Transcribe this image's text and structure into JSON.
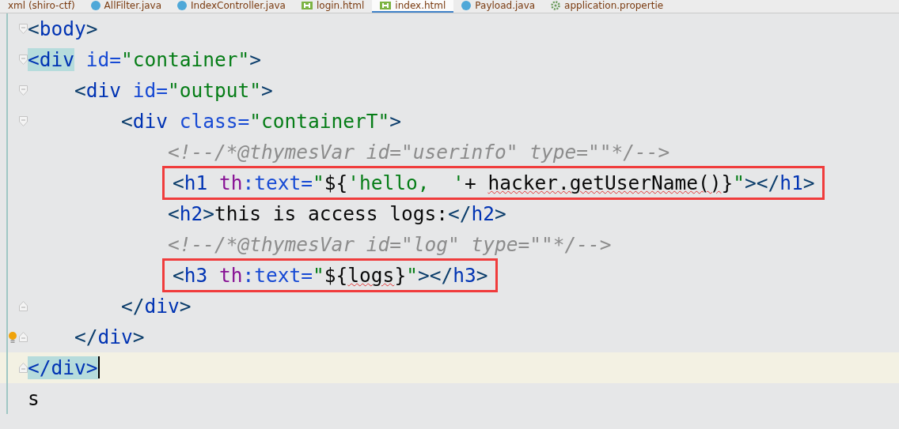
{
  "tabs": [
    {
      "label": "xml (shiro-ctf)",
      "kind": "xml",
      "selected": false
    },
    {
      "label": "AllFilter.java",
      "kind": "java",
      "selected": false
    },
    {
      "label": "IndexController.java",
      "kind": "java",
      "selected": false
    },
    {
      "label": "login.html",
      "kind": "html",
      "selected": false
    },
    {
      "label": "index.html",
      "kind": "html",
      "selected": true
    },
    {
      "label": "Payload.java",
      "kind": "java",
      "selected": false
    },
    {
      "label": "application.propertie",
      "kind": "properties",
      "selected": false
    }
  ],
  "editor": {
    "lines": [
      {
        "fold_open": true,
        "fold_close": false,
        "current": false,
        "bulb": false,
        "annotated": false,
        "tokens": [
          {
            "kind": "punct",
            "text": "<"
          },
          {
            "kind": "tag",
            "text": "body"
          },
          {
            "kind": "punct",
            "text": ">"
          }
        ]
      },
      {
        "fold_open": true,
        "fold_close": false,
        "current": false,
        "bulb": false,
        "annotated": false,
        "tokens": [
          {
            "kind": "tag",
            "text": "<div",
            "matched": true
          },
          {
            "kind": "attr",
            "text": " id="
          },
          {
            "kind": "string",
            "text": "\"container\""
          },
          {
            "kind": "punct",
            "text": ">"
          }
        ]
      },
      {
        "fold_open": true,
        "fold_close": false,
        "current": false,
        "bulb": false,
        "annotated": false,
        "tokens": [
          {
            "kind": "punct",
            "text": "    <"
          },
          {
            "kind": "tag",
            "text": "div"
          },
          {
            "kind": "attr",
            "text": " id="
          },
          {
            "kind": "string",
            "text": "\"output\""
          },
          {
            "kind": "punct",
            "text": ">"
          }
        ]
      },
      {
        "fold_open": true,
        "fold_close": false,
        "current": false,
        "bulb": false,
        "annotated": false,
        "tokens": [
          {
            "kind": "punct",
            "text": "        <"
          },
          {
            "kind": "tag",
            "text": "div"
          },
          {
            "kind": "attr",
            "text": " class="
          },
          {
            "kind": "string",
            "text": "\"containerT\""
          },
          {
            "kind": "punct",
            "text": ">"
          }
        ]
      },
      {
        "fold_open": false,
        "fold_close": false,
        "current": false,
        "bulb": false,
        "annotated": false,
        "tokens": [
          {
            "kind": "comment",
            "text": "            <!--/*@thymesVar id=\"userinfo\" type=\"\"*/-->"
          }
        ]
      },
      {
        "fold_open": false,
        "fold_close": false,
        "current": false,
        "bulb": false,
        "annotated": true,
        "tokens": [
          {
            "kind": "punct",
            "text": "            <"
          },
          {
            "kind": "tag",
            "text": "h1"
          },
          {
            "kind": "thattr",
            "text": " th"
          },
          {
            "kind": "attr",
            "text": ":text="
          },
          {
            "kind": "string",
            "text": "\""
          },
          {
            "kind": "text",
            "text": "${"
          },
          {
            "kind": "string",
            "text": "'hello,  '"
          },
          {
            "kind": "text",
            "text": "+ "
          },
          {
            "kind": "text",
            "text": "hacker.getUserName()",
            "error": true
          },
          {
            "kind": "text",
            "text": "}"
          },
          {
            "kind": "string",
            "text": "\""
          },
          {
            "kind": "punct",
            "text": "></"
          },
          {
            "kind": "tag",
            "text": "h1"
          },
          {
            "kind": "punct",
            "text": ">"
          }
        ]
      },
      {
        "fold_open": false,
        "fold_close": false,
        "current": false,
        "bulb": false,
        "annotated": false,
        "tokens": [
          {
            "kind": "punct",
            "text": "            <"
          },
          {
            "kind": "tag",
            "text": "h2"
          },
          {
            "kind": "punct",
            "text": ">"
          },
          {
            "kind": "text",
            "text": "this is access logs:"
          },
          {
            "kind": "punct",
            "text": "</"
          },
          {
            "kind": "tag",
            "text": "h2"
          },
          {
            "kind": "punct",
            "text": ">"
          }
        ]
      },
      {
        "fold_open": false,
        "fold_close": false,
        "current": false,
        "bulb": false,
        "annotated": false,
        "tokens": [
          {
            "kind": "comment",
            "text": "            <!--/*@thymesVar id=\"log\" type=\"\"*/-->"
          }
        ]
      },
      {
        "fold_open": false,
        "fold_close": false,
        "current": false,
        "bulb": false,
        "annotated": true,
        "tokens": [
          {
            "kind": "punct",
            "text": "            <"
          },
          {
            "kind": "tag",
            "text": "h3"
          },
          {
            "kind": "thattr",
            "text": " th"
          },
          {
            "kind": "attr",
            "text": ":text="
          },
          {
            "kind": "string",
            "text": "\""
          },
          {
            "kind": "text",
            "text": "${"
          },
          {
            "kind": "text",
            "text": "logs",
            "error": true
          },
          {
            "kind": "text",
            "text": "}"
          },
          {
            "kind": "string",
            "text": "\""
          },
          {
            "kind": "punct",
            "text": "></"
          },
          {
            "kind": "tag",
            "text": "h3"
          },
          {
            "kind": "punct",
            "text": ">"
          }
        ]
      },
      {
        "fold_open": false,
        "fold_close": true,
        "current": false,
        "bulb": false,
        "annotated": false,
        "tokens": [
          {
            "kind": "punct",
            "text": "        </"
          },
          {
            "kind": "tag",
            "text": "div"
          },
          {
            "kind": "punct",
            "text": ">"
          }
        ]
      },
      {
        "fold_open": false,
        "fold_close": true,
        "current": false,
        "bulb": true,
        "annotated": false,
        "tokens": [
          {
            "kind": "punct",
            "text": "    </"
          },
          {
            "kind": "tag",
            "text": "div"
          },
          {
            "kind": "punct",
            "text": ">"
          }
        ]
      },
      {
        "fold_open": false,
        "fold_close": true,
        "current": true,
        "bulb": false,
        "annotated": false,
        "tokens": [
          {
            "kind": "tag",
            "text": "</div>",
            "matched": true
          }
        ]
      },
      {
        "fold_open": false,
        "fold_close": false,
        "current": false,
        "bulb": false,
        "annotated": false,
        "tokens": [
          {
            "kind": "text",
            "text": "s"
          }
        ]
      }
    ]
  }
}
